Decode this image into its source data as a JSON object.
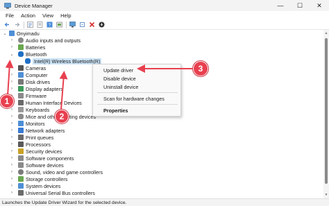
{
  "window": {
    "title": "Device Manager",
    "controls": {
      "minimize": "—",
      "maximize": "☐",
      "close": "✕"
    }
  },
  "menu": [
    "File",
    "Action",
    "View",
    "Help"
  ],
  "toolbar": {
    "icons": [
      "back-arrow-icon",
      "forward-arrow-icon",
      "tree-view-icon",
      "properties-icon",
      "help-icon",
      "update-driver-icon",
      "scan-monitor-icon",
      "add-device-icon",
      "uninstall-x-icon",
      "download-icon"
    ]
  },
  "tree": {
    "root": "Onyimadu",
    "categories": [
      "Audio inputs and outputs",
      "Batteries",
      "Bluetooth",
      "Intel(R) Wireless Bluetooth(R)",
      "Cameras",
      "Computer",
      "Disk drives",
      "Display adapters",
      "Firmware",
      "Human Interface Devices",
      "Keyboards",
      "Mice and other pointing devices",
      "Monitors",
      "Network adapters",
      "Print queues",
      "Processors",
      "Security devices",
      "Software components",
      "Software devices",
      "Sound, video and game controllers",
      "Storage controllers",
      "System devices",
      "Universal Serial Bus controllers"
    ]
  },
  "context_menu": {
    "update_driver": "Update driver",
    "disable_device": "Disable device",
    "uninstall_device": "Uninstall device",
    "scan": "Scan for hardware changes",
    "properties": "Properties"
  },
  "callouts": [
    "1",
    "2",
    "3"
  ],
  "status": "Launches the Update Driver Wizard for the selected device.",
  "colors": {
    "callout": "#e8404f",
    "selection": "#cce4f7"
  }
}
